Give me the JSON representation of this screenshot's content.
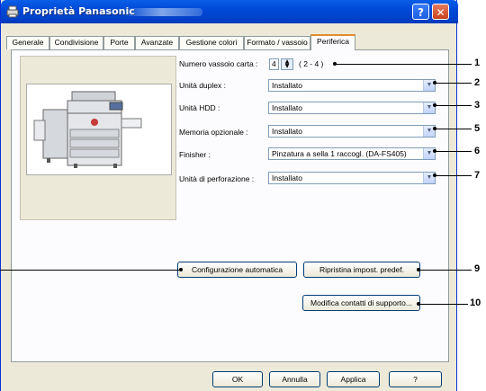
{
  "window": {
    "title": "Proprietà Panasonic"
  },
  "tabs": [
    "Generale",
    "Condivisione",
    "Porte",
    "Avanzate",
    "Gestione colori",
    "Formato / vassoio",
    "Periferica"
  ],
  "active_tab": "Periferica",
  "fields": {
    "tray_label": "Numero vassoio carta :",
    "tray_value": "4",
    "tray_range": "( 2 - 4 )",
    "duplex_label": "Unità duplex :",
    "duplex_value": "Installato",
    "hdd_label": "Unità HDD :",
    "hdd_value": "Installato",
    "memory_label": "Memoria opzionale :",
    "memory_value": "Installato",
    "finisher_label": "Finisher :",
    "finisher_value": "Pinzatura a sella 1 raccogl. (DA-FS405)",
    "punch_label": "Unità di perforazione :",
    "punch_value": "Installato"
  },
  "buttons": {
    "auto_config": "Configurazione automatica",
    "restore_defaults": "Ripristina impost. predef.",
    "support_contacts": "Modifica contatti di supporto...",
    "ok": "OK",
    "cancel": "Annulla",
    "apply": "Applica",
    "help": "?"
  },
  "callouts": [
    "1",
    "2",
    "3",
    "5",
    "6",
    "7",
    "9",
    "10"
  ],
  "titlebar_buttons": {
    "help": "?",
    "close": "✕"
  },
  "colors": {
    "titlebar": "#0049d8",
    "active_tab_accent": "#e68b2c",
    "dialog_bg": "#ece9d8"
  }
}
